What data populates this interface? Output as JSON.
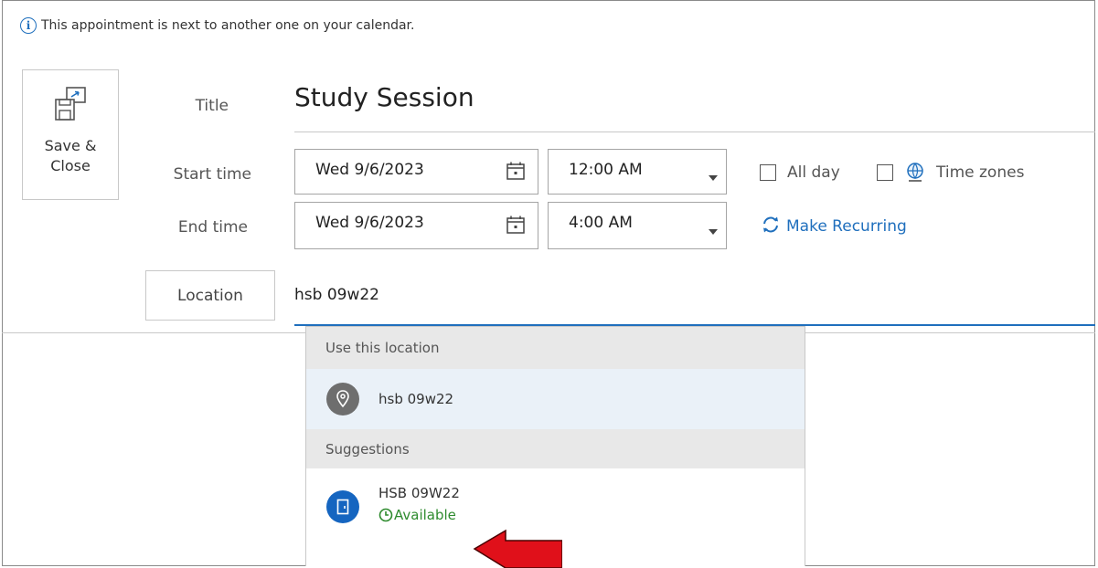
{
  "infobar": {
    "icon": "info-icon",
    "message": "This appointment is next to another one on your calendar."
  },
  "toolbar": {
    "save_close_line1": "Save &",
    "save_close_line2": "Close",
    "save_icon": "save-close-icon"
  },
  "form": {
    "title_label": "Title",
    "title_value": "Study Session",
    "start_label": "Start time",
    "start_date": "Wed 9/6/2023",
    "start_time": "12:00 AM",
    "end_label": "End time",
    "end_date": "Wed 9/6/2023",
    "end_time": "4:00 AM",
    "all_day_label": "All day",
    "all_day_checked": false,
    "time_zones_label": "Time zones",
    "time_zones_checked": false,
    "make_recurring_label": "Make Recurring",
    "location_button_label": "Location",
    "location_value": "hsb 09w22"
  },
  "location_dropdown": {
    "use_this_header": "Use this location",
    "use_this_item": "hsb 09w22",
    "suggestions_header": "Suggestions",
    "suggestions": [
      {
        "name": "HSB 09W22",
        "status": "Available"
      }
    ]
  },
  "colors": {
    "accent_blue": "#1f6fbd",
    "available_green": "#2e8b2e",
    "arrow_red": "#e0101a",
    "room_icon_blue": "#1565c0"
  }
}
